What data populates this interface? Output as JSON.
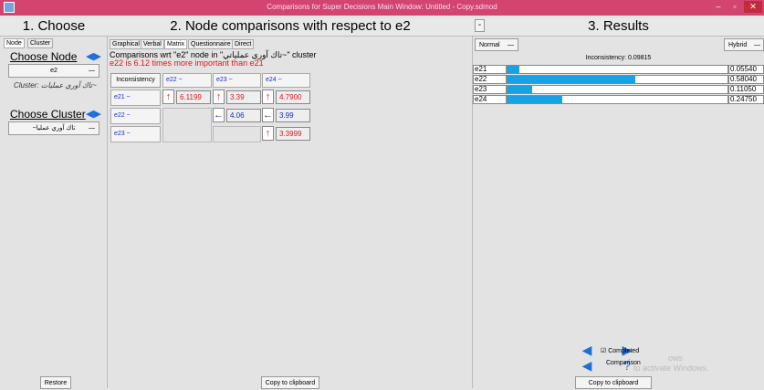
{
  "window": {
    "title": "Comparisons for Super Decisions Main Window: Untitled - Copy.sdmod",
    "minimize": "–",
    "maximize": "▫",
    "close": "✕"
  },
  "panels": {
    "choose": "1. Choose",
    "comparisons": "2. Node comparisons with respect to e2",
    "results": "3. Results"
  },
  "choose": {
    "tabs": [
      "Node",
      "Cluster"
    ],
    "choose_node_label": "Choose Node",
    "node_select": "e2",
    "node_select_arrow": "—",
    "cluster_caption": "Cluster: تاك آوري عمليات~",
    "choose_cluster_label": "Choose Cluster",
    "cluster_select": "~تاك آوري عمليا",
    "cluster_select_arrow": "—",
    "restore": "Restore"
  },
  "comparisons": {
    "tabs": [
      "Graphical",
      "Verbal",
      "Matrix",
      "Questionnaire",
      "Direct"
    ],
    "active_tab": "Matrix",
    "title_line": "Comparisons wrt \"e2\" node in \"تاك آوري عملياتي~\" cluster",
    "statement_line": "e22 is 6.12 times more important than e21",
    "inconsistency_button": "Inconsistency",
    "col_headers": [
      "e22",
      "e23",
      "e24"
    ],
    "row_headers": [
      "e21",
      "e22",
      "e23"
    ],
    "header_suffix": "~",
    "cells": [
      {
        "row": 0,
        "col": 0,
        "arrow": "↑",
        "color": "red",
        "value": "6.1199"
      },
      {
        "row": 0,
        "col": 1,
        "arrow": "↑",
        "color": "red",
        "value": "3.39"
      },
      {
        "row": 0,
        "col": 2,
        "arrow": "↑",
        "color": "red",
        "value": "4.7900"
      },
      {
        "row": 1,
        "col": 1,
        "arrow": "←",
        "color": "blue",
        "value": "4.06"
      },
      {
        "row": 1,
        "col": 2,
        "arrow": "←",
        "color": "blue",
        "value": "3.99"
      },
      {
        "row": 2,
        "col": 2,
        "arrow": "↑",
        "color": "red",
        "value": "3.3999"
      }
    ],
    "copy": "Copy to clipboard"
  },
  "results": {
    "collapse_button": "-",
    "mode_left": "Normal",
    "mode_right": "Hybrid",
    "mode_arrow": "—",
    "inconsistency_text": "Inconsistency: 0.09815",
    "rows": [
      {
        "name": "e21",
        "value": "0.05540",
        "fraction": 0.055
      },
      {
        "name": "e22",
        "value": "0.58040",
        "fraction": 0.58
      },
      {
        "name": "e23",
        "value": "0.11050",
        "fraction": 0.11
      },
      {
        "name": "e24",
        "value": "0.24750",
        "fraction": 0.247
      }
    ],
    "completed_label": "Completed",
    "comparison_label": "Comparison",
    "watermark_a": "ows",
    "watermark_b": "to activate Windows.",
    "copy": "Copy to clipboard",
    "accent": "#18a2e6"
  }
}
